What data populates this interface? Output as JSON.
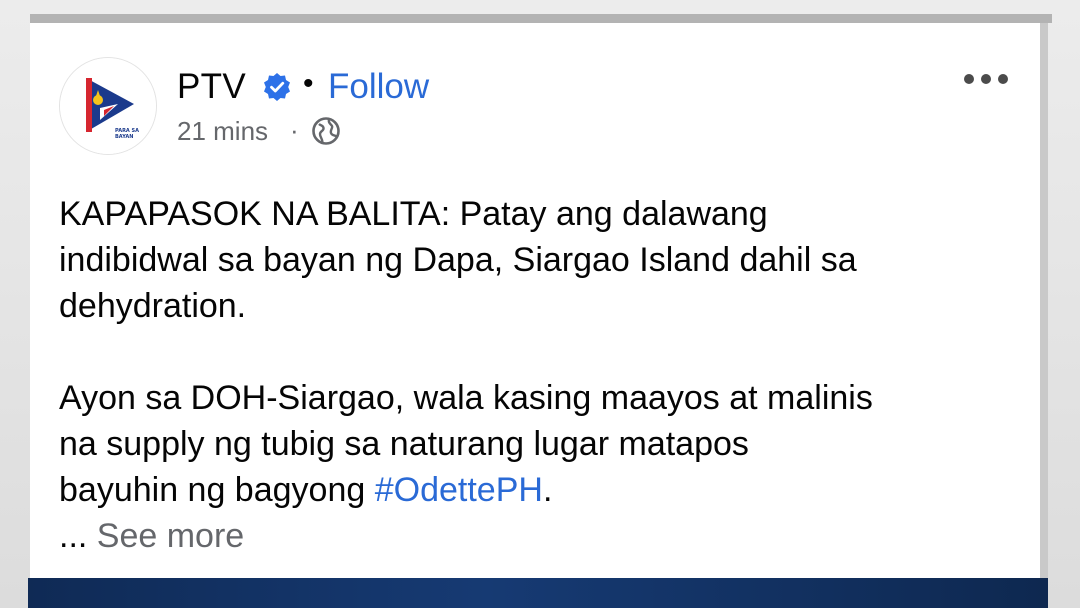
{
  "post": {
    "page_name": "PTV",
    "follow_label": "Follow",
    "separator": "•",
    "timestamp": "21 mins",
    "meta_separator": "·",
    "text": {
      "line1": "KAPAPASOK NA BALITA: Patay ang dalawang",
      "line2": "indibidwal sa bayan ng Dapa, Siargao Island dahil sa",
      "line3": "dehydration.",
      "line4": "Ayon sa DOH-Siargao, wala kasing maayos at malinis",
      "line5": "na supply ng tubig sa naturang lugar matapos",
      "line6_prefix": "bayuhin ng bagyong ",
      "hashtag": "#OdettePH",
      "line6_suffix": ".",
      "ellipsis": "... ",
      "see_more": "See more"
    },
    "avatar": {
      "logo_text": "PARA SA BAYAN"
    }
  },
  "icons": {
    "verified": "verified-badge-icon",
    "globe": "globe-icon",
    "more": "more-options-icon"
  },
  "colors": {
    "link_blue": "#2a6ad6",
    "secondary_text": "#65676b",
    "primary_text": "#050505",
    "verified_blue": "#2d71e8",
    "logo_blue": "#1b3a8c",
    "logo_red": "#d6262f",
    "logo_yellow": "#f6c31b"
  }
}
